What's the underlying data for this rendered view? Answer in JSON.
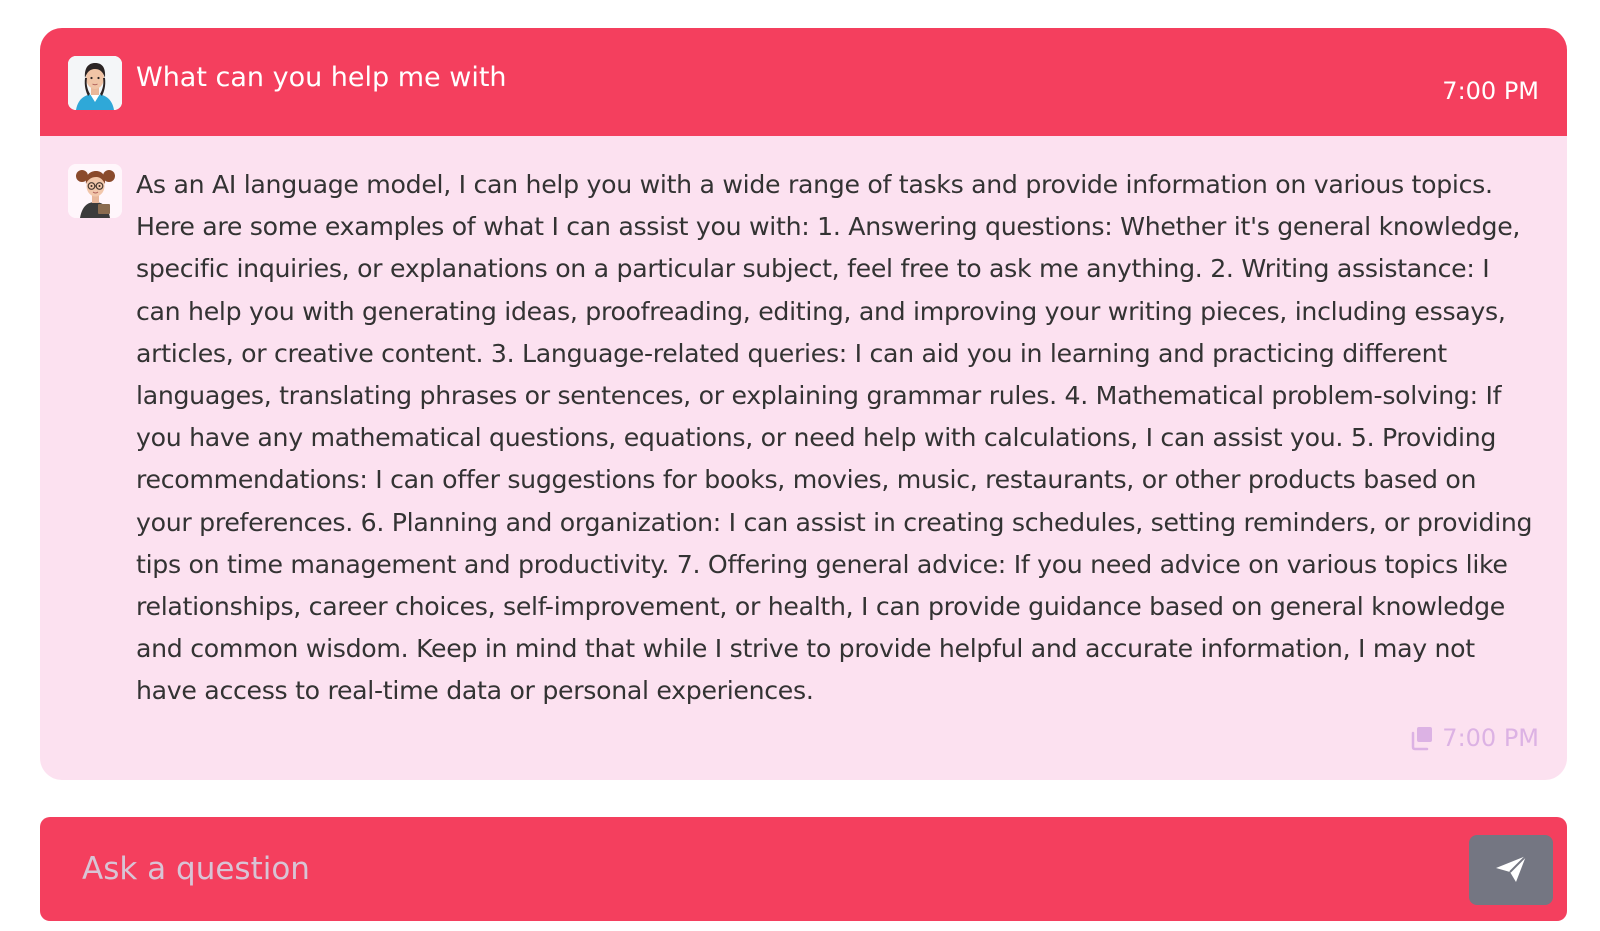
{
  "conversation": {
    "user_message": {
      "text": "What can you help me with",
      "time": "7:00 PM",
      "avatar_icon": "user-avatar-icon"
    },
    "bot_message": {
      "text": "As an AI language model, I can help you with a wide range of tasks and provide information on various topics. Here are some examples of what I can assist you with: 1. Answering questions: Whether it's general knowledge, specific inquiries, or explanations on a particular subject, feel free to ask me anything. 2. Writing assistance: I can help you with generating ideas, proofreading, editing, and improving your writing pieces, including essays, articles, or creative content. 3. Language-related queries: I can aid you in learning and practicing different languages, translating phrases or sentences, or explaining grammar rules. 4. Mathematical problem-solving: If you have any mathematical questions, equations, or need help with calculations, I can assist you. 5. Providing recommendations: I can offer suggestions for books, movies, music, restaurants, or other products based on your preferences. 6. Planning and organization: I can assist in creating schedules, setting reminders, or providing tips on time management and productivity. 7. Offering general advice: If you need advice on various topics like relationships, career choices, self-improvement, or health, I can provide guidance based on general knowledge and common wisdom. Keep in mind that while I strive to provide helpful and accurate information, I may not have access to real-time data or personal experiences.",
      "time": "7:00 PM",
      "avatar_icon": "assistant-avatar-icon",
      "copy_icon": "copy-icon"
    }
  },
  "input": {
    "placeholder": "Ask a question",
    "value": "",
    "send_icon": "paper-plane-icon"
  },
  "colors": {
    "accent": "#f43f5e",
    "bot_bubble": "#fce1f0",
    "send_button": "#747682"
  }
}
